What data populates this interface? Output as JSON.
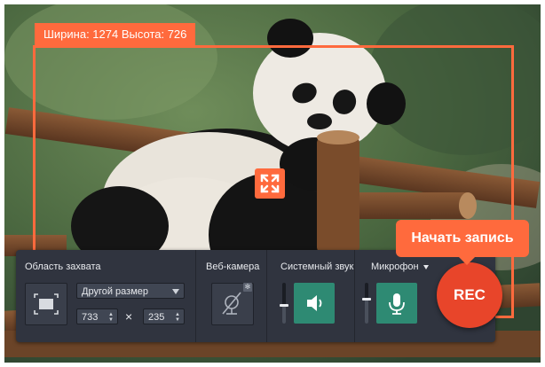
{
  "selection": {
    "dimensions_label": "Ширина: 1274 Высота: 726"
  },
  "panel": {
    "capture_area": {
      "title": "Область захвата",
      "size_select": "Другой размер",
      "width": "733",
      "height": "235",
      "times": "×"
    },
    "webcam": {
      "title": "Веб-камера"
    },
    "system_sound": {
      "title": "Системный звук",
      "level": 0.45
    },
    "microphone": {
      "title": "Микрофон",
      "level": 0.6
    }
  },
  "rec": {
    "label": "REC",
    "tooltip": "Начать запись"
  },
  "colors": {
    "accent": "#ff6a3d",
    "panel": "#30343f",
    "green": "#2e8a73",
    "rec": "#e8452a"
  },
  "icons": {
    "capture_area": "capture-area-icon",
    "center": "expand-arrows-icon",
    "webcam": "webcam-off-icon",
    "gear": "gear-icon",
    "speaker": "speaker-icon",
    "mic": "microphone-icon"
  }
}
